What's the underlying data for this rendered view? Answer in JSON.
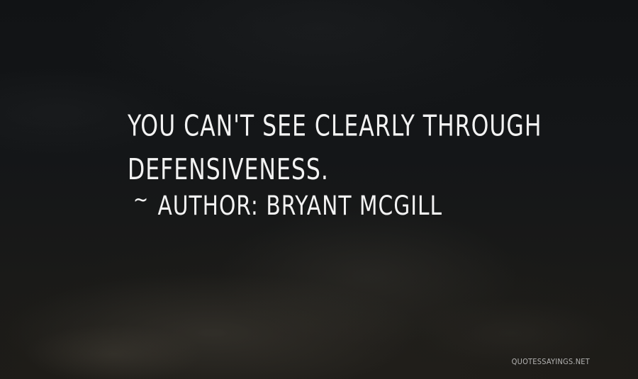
{
  "quote": {
    "text": "You can't see clearly through defensiveness.",
    "author_prefix": "~",
    "author_label": "Author:",
    "author_name": "Bryant McGill"
  },
  "site": {
    "watermark": "quotessayings.net"
  },
  "colors": {
    "text": "#f2f2f2",
    "background": "#111315"
  }
}
